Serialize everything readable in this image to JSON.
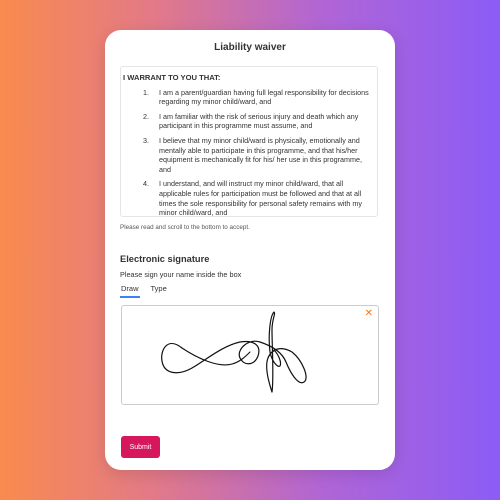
{
  "waiver": {
    "title": "Liability waiver",
    "heading": "I WARRANT TO YOU THAT:",
    "terms": [
      {
        "num": "1.",
        "text": "I am a parent/guardian having full legal responsibility for decisions regarding my minor child/ward, and"
      },
      {
        "num": "2.",
        "text": "I am familiar with the risk of serious injury and death which any participant in this programme must assume, and"
      },
      {
        "num": "3.",
        "text": "I believe that my minor child/ward is physically, emotionally and mentally able to participate in this programme, and that his/her equipment is mechanically fit for his/ her use in this programme, and"
      },
      {
        "num": "4.",
        "text": "I understand, and will instruct my minor child/ward, that all applicable rules for participation must be followed and that at all times the sole responsibility for personal safety remains with my minor child/ward, and"
      }
    ],
    "scroll_hint": "Please read and scroll to the bottom to accept."
  },
  "signature": {
    "heading": "Electronic signature",
    "instructions": "Please sign your name inside the box",
    "tabs": [
      {
        "label": "Draw",
        "active": true
      },
      {
        "label": "Type",
        "active": false
      }
    ],
    "clear_icon": "close-icon",
    "clear_symbol": "✕"
  },
  "submit_label": "Submit",
  "colors": {
    "accent_tab": "#3b82f6",
    "clear_icon": "#f97316",
    "submit_button": "#d6175c"
  }
}
